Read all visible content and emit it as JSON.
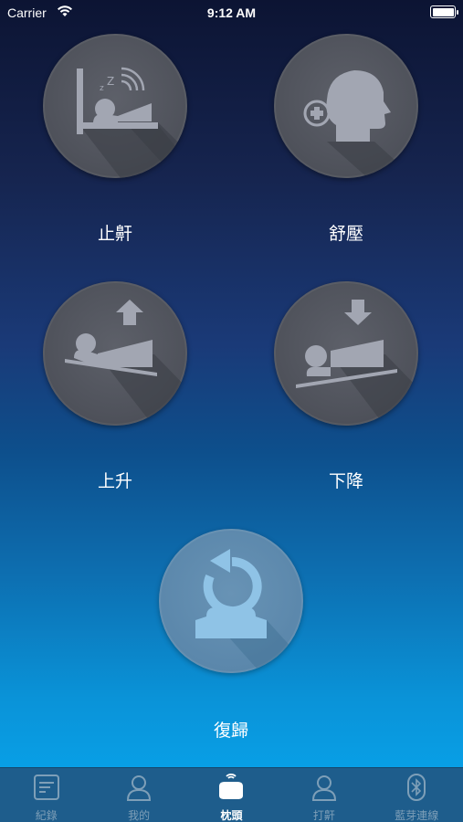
{
  "status_bar": {
    "carrier": "Carrier",
    "time": "9:12 AM"
  },
  "controls": {
    "stop_snore": {
      "label": "止鼾",
      "icon": "sleeping-snore-icon"
    },
    "relax": {
      "label": "舒壓",
      "icon": "head-massage-icon"
    },
    "raise": {
      "label": "上升",
      "icon": "pillow-raise-icon"
    },
    "lower": {
      "label": "下降",
      "icon": "pillow-lower-icon"
    },
    "reset": {
      "label": "復歸",
      "icon": "reset-rotate-icon"
    }
  },
  "tab_bar": {
    "items": [
      {
        "label": "紀錄",
        "icon": "document-icon",
        "active": false
      },
      {
        "label": "我的",
        "icon": "user-icon",
        "active": false
      },
      {
        "label": "枕頭",
        "icon": "pillow-icon",
        "active": true
      },
      {
        "label": "打鼾",
        "icon": "user-icon",
        "active": false
      },
      {
        "label": "藍芽連線",
        "icon": "bluetooth-icon",
        "active": false
      }
    ]
  },
  "colors": {
    "button_dark": "#505560",
    "button_light": "#5b87ab",
    "icon_fill": "#a2a6b2",
    "icon_fill_light": "#8fc3e6",
    "tab_bar": "#1e5d8c",
    "tab_inactive": "#7e9fb8",
    "tab_active": "#ffffff"
  }
}
